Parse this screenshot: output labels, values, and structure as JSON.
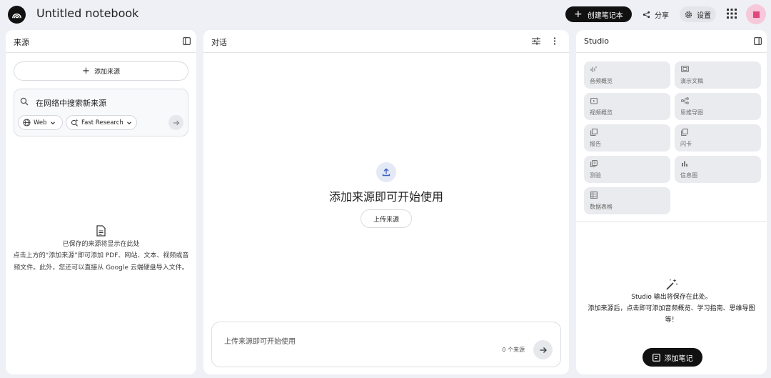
{
  "topbar": {
    "logo_icon": "notebook-logo-icon",
    "title": "Untitled notebook",
    "create_label": "创建笔记本",
    "share_label": "分享",
    "settings_label": "设置"
  },
  "sources": {
    "title": "来源",
    "add_label": "添加来源",
    "search_placeholder": "在网络中搜索新来源",
    "web_chip": "Web",
    "research_chip": "Fast Research",
    "empty_line1": "已保存的来源将显示在此处",
    "empty_line2": "点击上方的“添加来源”即可添加 PDF、网站、文本、视频或音频文件。此外，您还可以直接从 Google 云端硬盘导入文件。"
  },
  "chat": {
    "title": "对话",
    "heading": "添加来源即可开始使用",
    "upload_label": "上传来源",
    "input_placeholder": "上传来源即可开始使用",
    "source_count": "0 个来源"
  },
  "studio": {
    "title": "Studio",
    "tiles": [
      {
        "label": "音频概览",
        "icon": "audio-waveform-icon"
      },
      {
        "label": "演示文稿",
        "icon": "slides-icon"
      },
      {
        "label": "视频概览",
        "icon": "video-icon"
      },
      {
        "label": "思维导图",
        "icon": "mind-map-icon"
      },
      {
        "label": "报告",
        "icon": "report-icon"
      },
      {
        "label": "闪卡",
        "icon": "flashcards-icon"
      },
      {
        "label": "测验",
        "icon": "quiz-icon"
      },
      {
        "label": "信息图",
        "icon": "infographic-icon"
      },
      {
        "label": "数据表格",
        "icon": "data-table-icon"
      }
    ],
    "empty_line1": "Studio 输出将保存在此处。",
    "empty_line2": "添加来源后，点击即可添加音频概览、学习指南、思维导图等！",
    "add_note_label": "添加笔记"
  }
}
